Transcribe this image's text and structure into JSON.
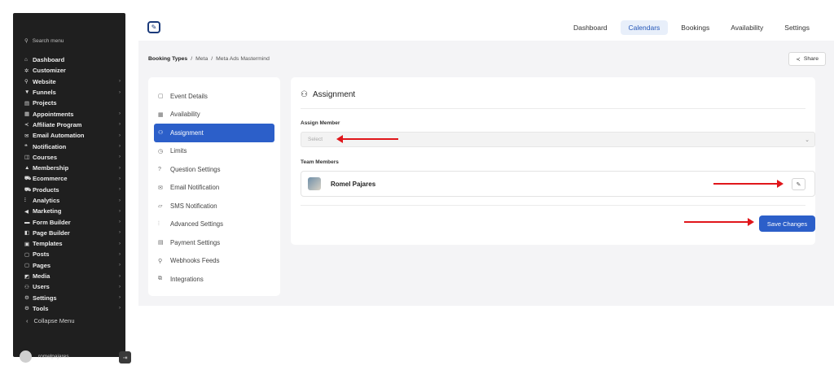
{
  "sidebar": {
    "search_placeholder": "Search menu",
    "items": [
      {
        "icon": "⌂",
        "label": "Dashboard",
        "has_children": false
      },
      {
        "icon": "✲",
        "label": "Customizer",
        "has_children": false
      },
      {
        "icon": "⚲",
        "label": "Website",
        "has_children": true
      },
      {
        "icon": "▼",
        "label": "Funnels",
        "has_children": true
      },
      {
        "icon": "▤",
        "label": "Projects",
        "has_children": false
      },
      {
        "icon": "▦",
        "label": "Appointments",
        "has_children": true
      },
      {
        "icon": "≺",
        "label": "Affiliate Program",
        "has_children": true
      },
      {
        "icon": "✉",
        "label": "Email Automation",
        "has_children": true
      },
      {
        "icon": "❝",
        "label": "Notification",
        "has_children": true
      },
      {
        "icon": "◫",
        "label": "Courses",
        "has_children": true
      },
      {
        "icon": "▲",
        "label": "Membership",
        "has_children": true
      },
      {
        "icon": "⛟",
        "label": "Ecommerce",
        "has_children": true
      },
      {
        "icon": "⛟",
        "label": "Products",
        "has_children": true
      },
      {
        "icon": "⫶",
        "label": "Analytics",
        "has_children": true
      },
      {
        "icon": "◀",
        "label": "Marketing",
        "has_children": true
      },
      {
        "icon": "▬",
        "label": "Form Builder",
        "has_children": true
      },
      {
        "icon": "◧",
        "label": "Page Builder",
        "has_children": true
      },
      {
        "icon": "▣",
        "label": "Templates",
        "has_children": true
      },
      {
        "icon": "▢",
        "label": "Posts",
        "has_children": true
      },
      {
        "icon": "▢",
        "label": "Pages",
        "has_children": true
      },
      {
        "icon": "◩",
        "label": "Media",
        "has_children": true
      },
      {
        "icon": "⚇",
        "label": "Users",
        "has_children": true
      },
      {
        "icon": "⚙",
        "label": "Settings",
        "has_children": true
      },
      {
        "icon": "⚙",
        "label": "Tools",
        "has_children": true
      }
    ],
    "collapse_label": "Collapse Menu",
    "username": "romelpajares"
  },
  "topnav": {
    "items": [
      "Dashboard",
      "Calendars",
      "Bookings",
      "Availability",
      "Settings"
    ],
    "active": "Calendars"
  },
  "breadcrumb": {
    "root": "Booking Types",
    "sep": "/",
    "level2": "Meta",
    "level3": "Meta Ads Mastermind"
  },
  "share_label": "Share",
  "settings_menu": {
    "items": [
      {
        "icon": "▢",
        "label": "Event Details"
      },
      {
        "icon": "▦",
        "label": "Availability"
      },
      {
        "icon": "⚇",
        "label": "Assignment"
      },
      {
        "icon": "◷",
        "label": "Limits"
      },
      {
        "icon": "?",
        "label": "Question Settings"
      },
      {
        "icon": "✉",
        "label": "Email Notification"
      },
      {
        "icon": "▱",
        "label": "SMS Notification"
      },
      {
        "icon": "⫶",
        "label": "Advanced Settings"
      },
      {
        "icon": "▤",
        "label": "Payment Settings"
      },
      {
        "icon": "⚲",
        "label": "Webhooks Feeds"
      },
      {
        "icon": "⧉",
        "label": "Integrations"
      }
    ],
    "active": "Assignment"
  },
  "assignment": {
    "title": "Assignment",
    "assign_member_label": "Assign Member",
    "select_placeholder": "Select",
    "team_members_label": "Team Members",
    "members": [
      {
        "name": "Romel Pajares"
      }
    ],
    "save_label": "Save Changes"
  },
  "colors": {
    "accent": "#2c5fc9",
    "sidebar_bg": "#1f1f1f",
    "annotation_arrow": "#e0161b"
  }
}
